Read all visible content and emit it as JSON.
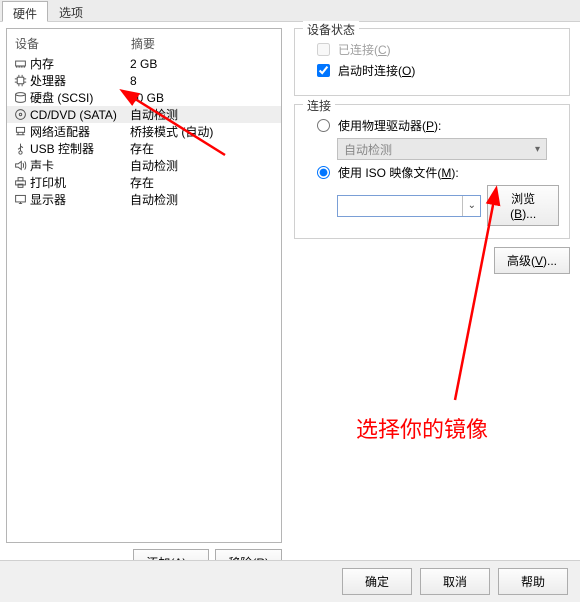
{
  "tabs": {
    "t0": "硬件",
    "t1": "选项"
  },
  "left": {
    "header_device": "设备",
    "header_summary": "摘要",
    "rows": {
      "r0": {
        "icon": "memory-icon",
        "name": "内存",
        "sum": "2 GB"
      },
      "r1": {
        "icon": "cpu-icon",
        "name": "处理器",
        "sum": "8"
      },
      "r2": {
        "icon": "disk-icon",
        "name": "硬盘 (SCSI)",
        "sum": "60 GB"
      },
      "r3": {
        "icon": "disc-icon",
        "name": "CD/DVD (SATA)",
        "sum": "自动检测"
      },
      "r4": {
        "icon": "network-icon",
        "name": "网络适配器",
        "sum": "桥接模式 (自动)"
      },
      "r5": {
        "icon": "usb-icon",
        "name": "USB 控制器",
        "sum": "存在"
      },
      "r6": {
        "icon": "sound-icon",
        "name": "声卡",
        "sum": "自动检测"
      },
      "r7": {
        "icon": "printer-icon",
        "name": "打印机",
        "sum": "存在"
      },
      "r8": {
        "icon": "display-icon",
        "name": "显示器",
        "sum": "自动检测"
      }
    },
    "add_btn": "添加(A)...",
    "remove_btn": "移除(R)"
  },
  "right": {
    "status_group": "设备状态",
    "connected_label": "已连接(C)",
    "connect_on_power_label": "启动时连接(O)",
    "conn_group": "连接",
    "use_physical_label": "使用物理驱动器(P):",
    "physical_value": "自动检测",
    "use_iso_label": "使用 ISO 映像文件(M):",
    "browse_btn": "浏览(B)...",
    "advanced_btn": "高级(V)..."
  },
  "bottom": {
    "ok": "确定",
    "cancel": "取消",
    "help": "帮助"
  },
  "annotation": {
    "text": "选择你的镜像"
  }
}
